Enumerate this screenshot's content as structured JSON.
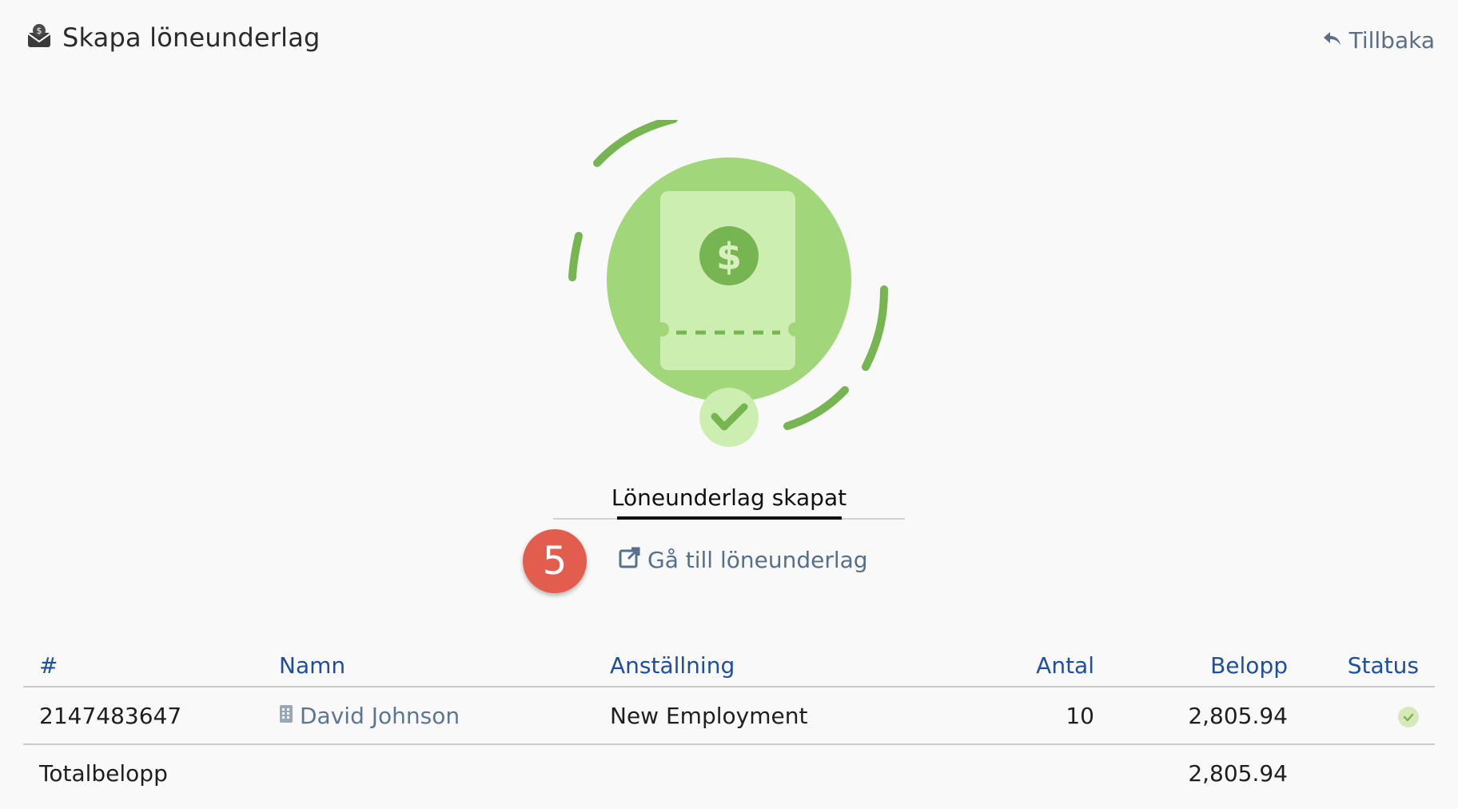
{
  "header": {
    "title": "Skapa löneunderlag",
    "back_label": "Tillbaka"
  },
  "result": {
    "title": "Löneunderlag skapat",
    "link_label": "Gå till löneunderlag",
    "step_badge": "5"
  },
  "table": {
    "columns": [
      "#",
      "Namn",
      "Anställning",
      "Antal",
      "Belopp",
      "Status"
    ],
    "rows": [
      {
        "id": "2147483647",
        "name": "David Johnson",
        "employment": "New Employment",
        "antal": "10",
        "belopp": "2,805.94",
        "status": "success-check-icon"
      }
    ],
    "total_label": "Totalbelopp",
    "total_amount": "2,805.94"
  },
  "colors": {
    "accent_blue": "#1f4f9c",
    "link_gray_blue": "#556f8d",
    "hero_green": "#a2d67a",
    "hero_dark_green": "#77b552",
    "step_badge_red": "#e35d4f"
  },
  "icons": {
    "header": "money-envelope-icon",
    "back": "reply-arrow-icon",
    "link": "external-link-icon",
    "name": "building-icon",
    "status": "check-icon"
  }
}
